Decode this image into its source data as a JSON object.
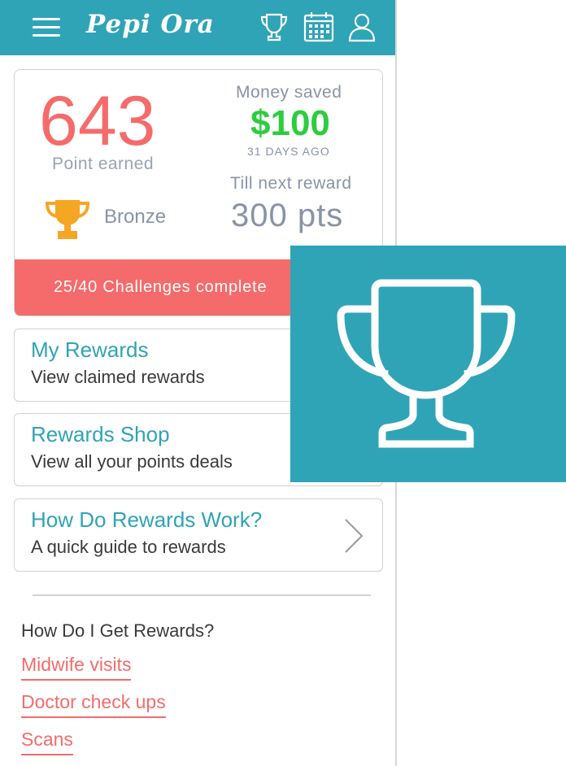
{
  "app": {
    "title": "Pepi Ora"
  },
  "header": {
    "menu_icon": "hamburger-menu-icon",
    "icons": [
      "trophy-icon",
      "calendar-icon",
      "user-icon"
    ]
  },
  "summary": {
    "points_value": "643",
    "points_label": "Point earned",
    "tier_label": "Bronze",
    "money_saved_label": "Money saved",
    "money_saved_value": "$100",
    "money_saved_when": "31 DAYS AGO",
    "next_reward_label": "Till next reward",
    "next_reward_value": "300 pts",
    "challenges_text": "25/40 Challenges complete"
  },
  "menu_rows": [
    {
      "title": "My Rewards",
      "subtitle": "View claimed rewards"
    },
    {
      "title": "Rewards Shop",
      "subtitle": "View all your points deals"
    },
    {
      "title": "How Do Rewards Work?",
      "subtitle": "A quick guide to rewards"
    }
  ],
  "how_section": {
    "title": "How Do I Get Rewards?",
    "links": [
      "Midwife visits",
      "Doctor check ups",
      "Scans"
    ]
  },
  "colors": {
    "brand": "#2fa4b6",
    "accent_red": "#f56b6b",
    "money_green": "#2ecc40",
    "trophy_gold": "#f5a623"
  }
}
